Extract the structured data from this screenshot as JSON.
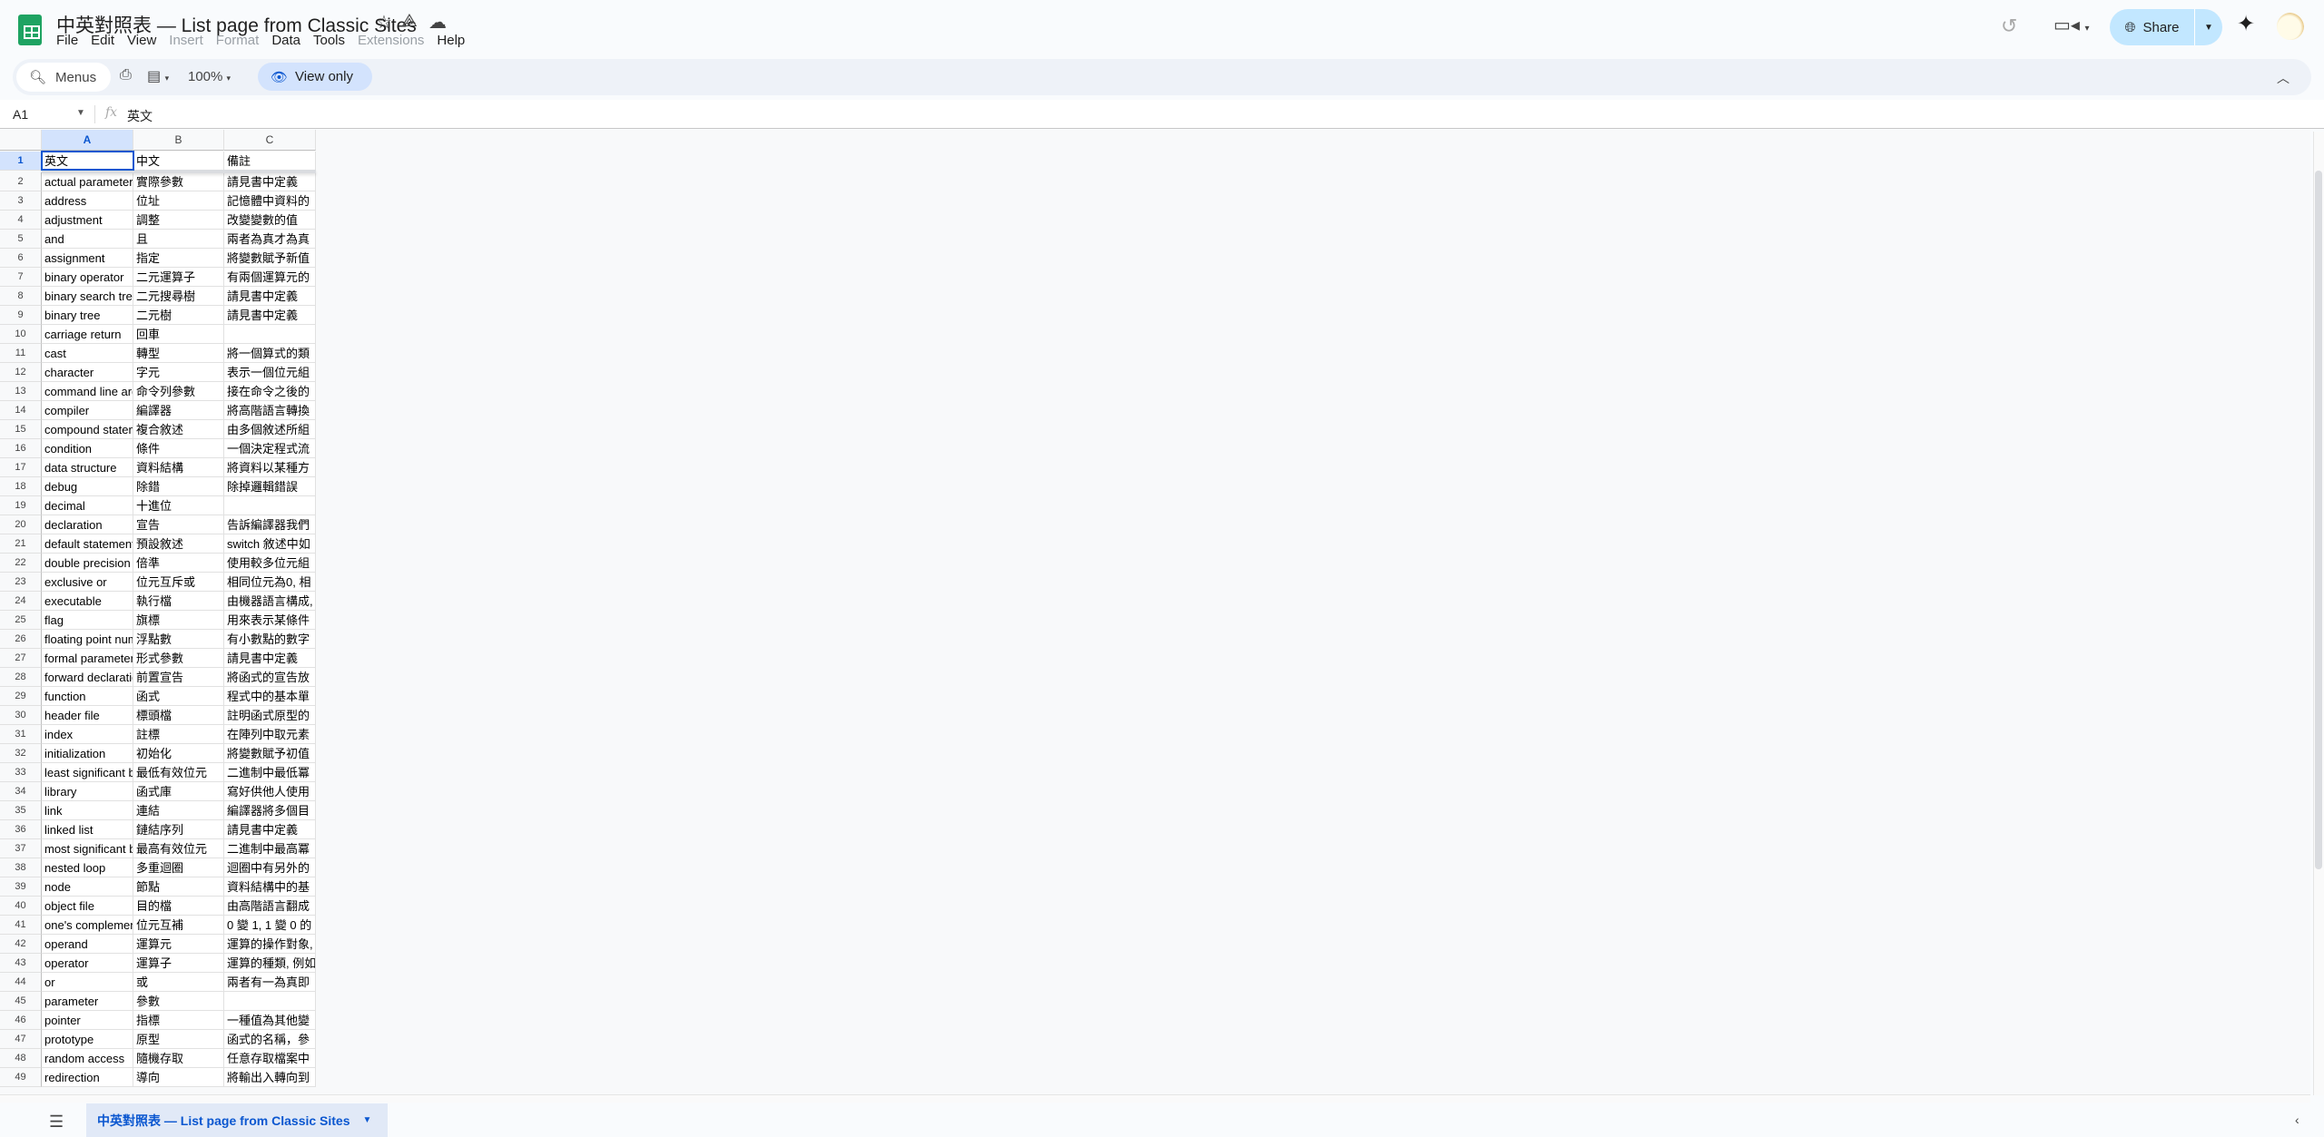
{
  "app": {
    "title": "中英對照表 — List page from Classic Sites",
    "icons": [
      "star-icon",
      "drive-shortcut-icon",
      "cloud-saved-icon"
    ]
  },
  "menu": [
    {
      "label": "File",
      "enabled": true
    },
    {
      "label": "Edit",
      "enabled": true
    },
    {
      "label": "View",
      "enabled": true
    },
    {
      "label": "Insert",
      "enabled": false
    },
    {
      "label": "Format",
      "enabled": false
    },
    {
      "label": "Data",
      "enabled": true
    },
    {
      "label": "Tools",
      "enabled": true
    },
    {
      "label": "Extensions",
      "enabled": false
    },
    {
      "label": "Help",
      "enabled": true
    }
  ],
  "toolbar": {
    "menus_label": "Menus",
    "zoom": "100%",
    "view_only_label": "View only"
  },
  "header_right": {
    "share_label": "Share"
  },
  "formula_bar": {
    "cell_ref": "A1",
    "fx": "fx",
    "value": "英文"
  },
  "columns": [
    "A",
    "B",
    "C"
  ],
  "selected_cell": "A1",
  "rows": [
    [
      "英文",
      "中文",
      "備註"
    ],
    [
      "actual parameter",
      "實際參數",
      "請見書中定義"
    ],
    [
      "address",
      "位址",
      "記憶體中資料的"
    ],
    [
      "adjustment",
      "調整",
      "改變變數的值"
    ],
    [
      "and",
      "且",
      "兩者為真才為真"
    ],
    [
      "assignment",
      "指定",
      "將變數賦予新值"
    ],
    [
      "binary operator",
      "二元運算子",
      "有兩個運算元的"
    ],
    [
      "binary search tree",
      "二元搜尋樹",
      "請見書中定義"
    ],
    [
      "binary tree",
      "二元樹",
      "請見書中定義"
    ],
    [
      "carriage return",
      "回車",
      ""
    ],
    [
      "cast",
      "轉型",
      "將一個算式的類"
    ],
    [
      "character",
      "字元",
      "表示一個位元組"
    ],
    [
      "command line arg",
      "命令列參數",
      "接在命令之後的"
    ],
    [
      "compiler",
      "編譯器",
      "將高階語言轉換"
    ],
    [
      "compound statement",
      "複合敘述",
      "由多個敘述所組"
    ],
    [
      "condition",
      "條件",
      "一個決定程式流"
    ],
    [
      "data structure",
      "資料結構",
      "將資料以某種方"
    ],
    [
      "debug",
      "除錯",
      "除掉邏輯錯誤"
    ],
    [
      "decimal",
      "十進位",
      ""
    ],
    [
      "declaration",
      "宣告",
      "告訴編譯器我們"
    ],
    [
      "default statement",
      "預設敘述",
      "switch 敘述中如"
    ],
    [
      "double precision",
      "倍準",
      "使用較多位元組"
    ],
    [
      "exclusive or",
      "位元互斥或",
      "相同位元為0, 相"
    ],
    [
      "executable",
      "執行檔",
      "由機器語言構成,"
    ],
    [
      "flag",
      "旗標",
      "用來表示某條件"
    ],
    [
      "floating point number",
      "浮點數",
      "有小數點的數字"
    ],
    [
      "formal parameter",
      "形式參數",
      "請見書中定義"
    ],
    [
      "forward declaration",
      "前置宣告",
      "將函式的宣告放"
    ],
    [
      "function",
      "函式",
      "程式中的基本單"
    ],
    [
      "header file",
      "標頭檔",
      "註明函式原型的"
    ],
    [
      "index",
      "註標",
      "在陣列中取元素"
    ],
    [
      "initialization",
      "初始化",
      "將變數賦予初值"
    ],
    [
      "least significant bit",
      "最低有效位元",
      "二進制中最低冪"
    ],
    [
      "library",
      "函式庫",
      "寫好供他人使用"
    ],
    [
      "link",
      "連結",
      "編譯器將多個目"
    ],
    [
      "linked list",
      "鏈結序列",
      "請見書中定義"
    ],
    [
      "most significant bit",
      "最高有效位元",
      "二進制中最高冪"
    ],
    [
      "nested loop",
      "多重迴圈",
      "迴圈中有另外的"
    ],
    [
      "node",
      "節點",
      "資料結構中的基"
    ],
    [
      "object file",
      "目的檔",
      "由高階語言翻成"
    ],
    [
      "one's complement",
      "位元互補",
      "0 變 1, 1 變 0 的"
    ],
    [
      "operand",
      "運算元",
      "運算的操作對象,"
    ],
    [
      "operator",
      "運算子",
      "運算的種類, 例如"
    ],
    [
      "or",
      "或",
      "兩者有一為真即"
    ],
    [
      "parameter",
      "參數",
      ""
    ],
    [
      "pointer",
      "指標",
      "一種值為其他變"
    ],
    [
      "prototype",
      "原型",
      "函式的名稱，參"
    ],
    [
      "random access",
      "隨機存取",
      "任意存取檔案中"
    ],
    [
      "redirection",
      "導向",
      "將輸出入轉向到"
    ]
  ],
  "sheet_tabs": [
    {
      "label": "中英對照表 — List page from Classic Sites",
      "active": true
    }
  ],
  "colors": {
    "accent": "#0b57d0",
    "share_bg": "#c2e7ff",
    "selection": "#d3e3fd",
    "sheets_green": "#1ea362"
  }
}
